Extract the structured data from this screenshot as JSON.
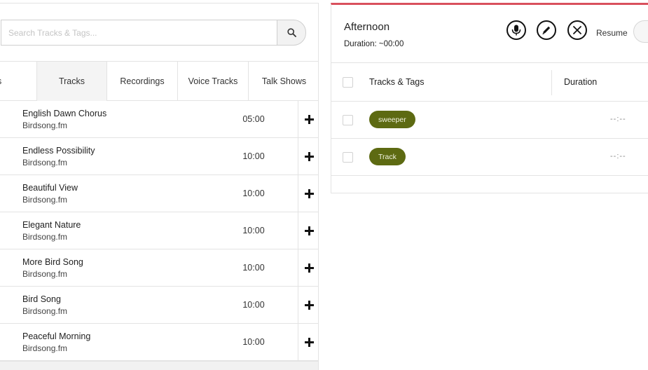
{
  "search": {
    "placeholder": "Search Tracks & Tags..."
  },
  "tabs": [
    {
      "label": "gs"
    },
    {
      "label": "Tracks"
    },
    {
      "label": "Recordings"
    },
    {
      "label": "Voice Tracks"
    },
    {
      "label": "Talk Shows"
    }
  ],
  "tracks": [
    {
      "title": "English Dawn Chorus",
      "artist": "Birdsong.fm",
      "duration": "05:00"
    },
    {
      "title": "Endless Possibility",
      "artist": "Birdsong.fm",
      "duration": "10:00"
    },
    {
      "title": "Beautiful View",
      "artist": "Birdsong.fm",
      "duration": "10:00"
    },
    {
      "title": "Elegant Nature",
      "artist": "Birdsong.fm",
      "duration": "10:00"
    },
    {
      "title": "More Bird Song",
      "artist": "Birdsong.fm",
      "duration": "10:00"
    },
    {
      "title": "Bird Song",
      "artist": "Birdsong.fm",
      "duration": "10:00"
    },
    {
      "title": "Peaceful Morning",
      "artist": "Birdsong.fm",
      "duration": "10:00"
    }
  ],
  "playlist": {
    "title": "Afternoon",
    "duration_label": "Duration: ~00:00",
    "resume_label": "Resume",
    "columns": {
      "tracks_tags": "Tracks & Tags",
      "duration": "Duration"
    },
    "rows": [
      {
        "tag": "sweeper",
        "duration": "--:--"
      },
      {
        "tag": "Track",
        "duration": "--:--"
      }
    ]
  },
  "colors": {
    "accent_bar": "#d9505d",
    "tag_pill": "#5d6a12"
  }
}
